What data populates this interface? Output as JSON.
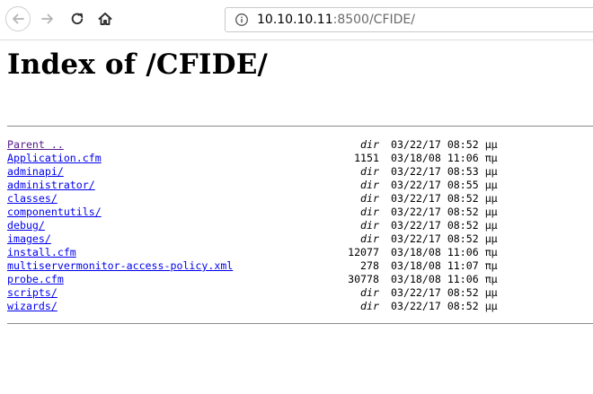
{
  "browser": {
    "url_host": "10.10.10.11",
    "url_rest": ":8500/CFIDE/"
  },
  "page": {
    "title": "Index of /CFIDE/"
  },
  "listing": [
    {
      "name": "Parent ..",
      "size": "dir",
      "date": "03/22/17 08:52 μμ"
    },
    {
      "name": "Application.cfm",
      "size": "1151",
      "date": "03/18/08 11:06 πμ"
    },
    {
      "name": "adminapi/",
      "size": "dir",
      "date": "03/22/17 08:53 μμ"
    },
    {
      "name": "administrator/",
      "size": "dir",
      "date": "03/22/17 08:55 μμ"
    },
    {
      "name": "classes/",
      "size": "dir",
      "date": "03/22/17 08:52 μμ"
    },
    {
      "name": "componentutils/",
      "size": "dir",
      "date": "03/22/17 08:52 μμ"
    },
    {
      "name": "debug/",
      "size": "dir",
      "date": "03/22/17 08:52 μμ"
    },
    {
      "name": "images/",
      "size": "dir",
      "date": "03/22/17 08:52 μμ"
    },
    {
      "name": "install.cfm",
      "size": "12077",
      "date": "03/18/08 11:06 πμ"
    },
    {
      "name": "multiservermonitor-access-policy.xml",
      "size": "278",
      "date": "03/18/08 11:07 πμ"
    },
    {
      "name": "probe.cfm",
      "size": "30778",
      "date": "03/18/08 11:06 πμ"
    },
    {
      "name": "scripts/",
      "size": "dir",
      "date": "03/22/17 08:52 μμ"
    },
    {
      "name": "wizards/",
      "size": "dir",
      "date": "03/22/17 08:52 μμ"
    }
  ]
}
